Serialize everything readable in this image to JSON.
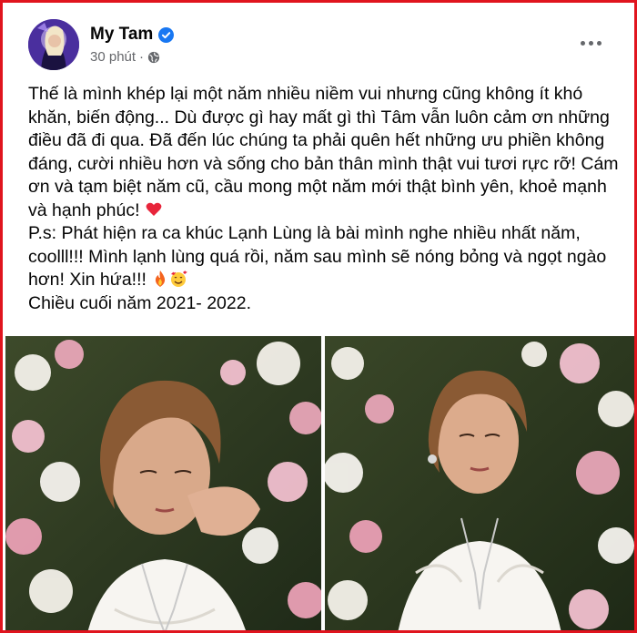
{
  "post": {
    "author": "My Tam",
    "verified": true,
    "timestamp": "30 phút",
    "privacy_icon": "globe-icon",
    "more_icon": "more-options-icon",
    "paragraphs": [
      "Thế là mình khép lại một năm nhiều niềm vui nhưng cũng không ít khó khăn, biến động... Dù được gì hay mất gì thì Tâm vẫn luôn cảm ơn những điều đã đi qua. Đã đến lúc chúng ta phải quên hết những ưu phiền không đáng, cười nhiều hơn và sống cho bản thân mình thật vui tươi rực rỡ! Cám ơn và tạm biệt năm cũ, cầu mong một năm mới thật bình yên, khoẻ mạnh và hạnh phúc!",
      "P.s: Phát hiện ra ca khúc Lạnh Lùng là bài mình nghe nhiều nhất năm, coolll!!! Mình lạnh lùng quá rồi, năm sau mình sẽ nóng bỏng và ngọt ngào hơn! Xin hứa!!!",
      "Chiều cuối năm 2021- 2022."
    ],
    "emojis": [
      "red-heart-emoji",
      "fire-emoji",
      "smiling-face-with-hearts-emoji"
    ],
    "photos": [
      "photo-1",
      "photo-2"
    ]
  },
  "colors": {
    "frame_border": "#e0141e",
    "verified_badge": "#1877f2",
    "secondary_text": "#65676b"
  }
}
